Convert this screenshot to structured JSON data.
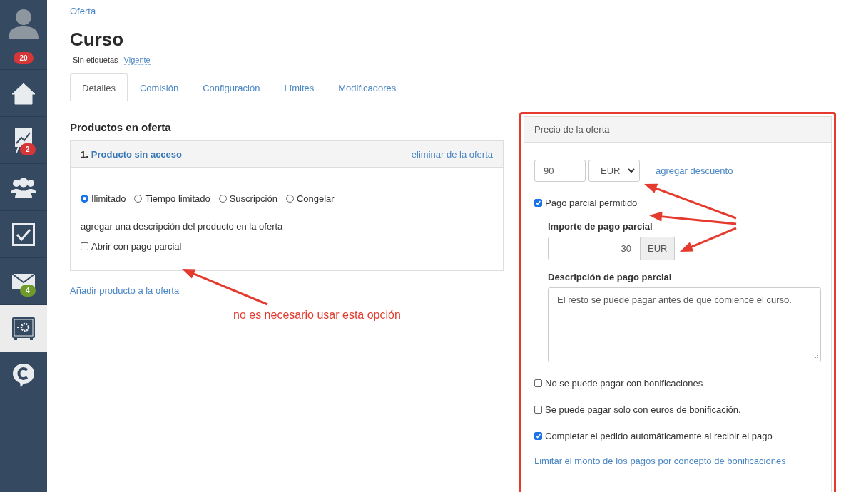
{
  "sidebar": {
    "items": [
      {
        "kind": "avatar",
        "selected": false
      },
      {
        "kind": "counter",
        "badge": "20",
        "color": "#d63638",
        "selected": false
      },
      {
        "kind": "home",
        "selected": false
      },
      {
        "kind": "chart",
        "badge": "2",
        "color": "#d63638",
        "selected": false
      },
      {
        "kind": "people",
        "selected": false
      },
      {
        "kind": "tasks",
        "selected": false
      },
      {
        "kind": "mail",
        "badge": "4",
        "color": "#6f9a2c",
        "selected": false
      },
      {
        "kind": "safe",
        "selected": true
      },
      {
        "kind": "chat",
        "selected": false
      }
    ]
  },
  "breadcrumb": "Oferta",
  "title": "Curso",
  "tags": "Sin etiquetas",
  "status": "Vigente",
  "tabs": [
    {
      "label": "Detalles",
      "selected": true
    },
    {
      "label": "Comisión",
      "selected": false
    },
    {
      "label": "Configuración",
      "selected": false
    },
    {
      "label": "Límites",
      "selected": false
    },
    {
      "label": "Modificadores",
      "selected": false
    }
  ],
  "products": {
    "heading": "Productos en oferta",
    "items": [
      {
        "number": "1.",
        "name": "Producto sin acceso",
        "remove": "eliminar de la oferta",
        "access": [
          {
            "label": "Ilimitado",
            "selected": true
          },
          {
            "label": "Tiempo limitado",
            "selected": false
          },
          {
            "label": "Suscripción",
            "selected": false
          },
          {
            "label": "Congelar",
            "selected": false
          }
        ],
        "description_link": "agregar una descripción del producto en la oferta",
        "partial": {
          "label": "Abrir con pago parcial",
          "checked": false
        }
      }
    ],
    "add_link": "Añadir producto a la oferta"
  },
  "note": "no es necesario usar esta opción",
  "price_panel": {
    "title": "Precio de la oferta",
    "price": "90",
    "currency": "EUR",
    "discount_link": "agregar descuento",
    "partial_allowed": {
      "label": "Pago parcial permitido",
      "checked": true
    },
    "partial_amount_label": "Importe de pago parcial",
    "partial_amount": "30",
    "partial_unit": "EUR",
    "partial_description_label": "Descripción de pago parcial",
    "partial_description": "El resto se puede pagar antes de que comience el curso.",
    "options": [
      {
        "label": "No se puede pagar con bonificaciones",
        "checked": false
      },
      {
        "label": "Se puede pagar solo con euros de bonificación.",
        "checked": false
      },
      {
        "label": "Completar el pedido automáticamente al recibir el pago",
        "checked": true
      }
    ],
    "limit_link": "Limitar el monto de los pagos por concepto de bonificaciones"
  }
}
